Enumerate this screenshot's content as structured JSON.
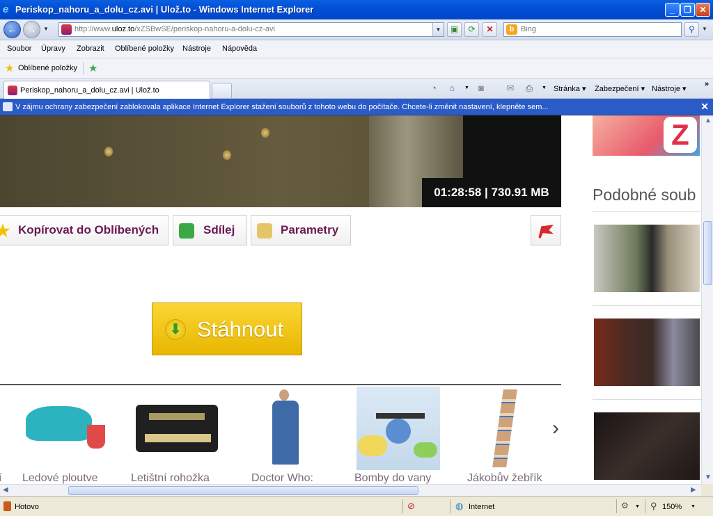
{
  "window": {
    "title": "Periskop_nahoru_a_dolu_cz.avi | Ulož.to - Windows Internet Explorer",
    "minimize": "_",
    "maximize": "❐",
    "close": "✕"
  },
  "navbar": {
    "back": "←",
    "forward": "→",
    "url_prefix": "http://www.",
    "url_domain": "uloz.to",
    "url_path": "/xZSBwSE/periskop-nahoru-a-dolu-cz-avi",
    "search_placeholder": "Bing"
  },
  "menu": [
    "Soubor",
    "Úpravy",
    "Zobrazit",
    "Oblíbené položky",
    "Nástroje",
    "Nápověda"
  ],
  "favorites": {
    "label": "Oblíbené položky"
  },
  "tabs": {
    "active_label": "Periskop_nahoru_a_dolu_cz.avi | Ulož.to"
  },
  "commandbar": {
    "page": "Stránka",
    "security": "Zabezpečení",
    "tools": "Nástroje"
  },
  "infobar": {
    "message": "V zájmu ochrany zabezpečení zablokovala aplikace Internet Explorer stažení souborů z tohoto webu do počítače. Chcete-li změnit nastavení, klepněte sem..."
  },
  "video": {
    "duration_size": "01:28:58 | 730.91 MB"
  },
  "actions": {
    "favorite": "Kopírovat do Oblíbených",
    "share": "Sdílej",
    "params": "Parametry"
  },
  "download": {
    "label": "Stáhnout"
  },
  "carousel": {
    "items": [
      {
        "name": "Ledové ploutve"
      },
      {
        "name": "Letištní rohožka"
      },
      {
        "name": "Doctor Who:"
      },
      {
        "name": "Bomby do vany"
      },
      {
        "name": "Jákobův žebřík"
      }
    ],
    "next": "›"
  },
  "sidebar": {
    "title": "Podobné soub"
  },
  "statusbar": {
    "status": "Hotovo",
    "zone": "Internet",
    "zoom": "150%"
  },
  "colors": {
    "titlebar": "#0350d8",
    "infobar": "#2a5bc7",
    "download": "#f4c400",
    "action_text": "#6a1a55"
  }
}
